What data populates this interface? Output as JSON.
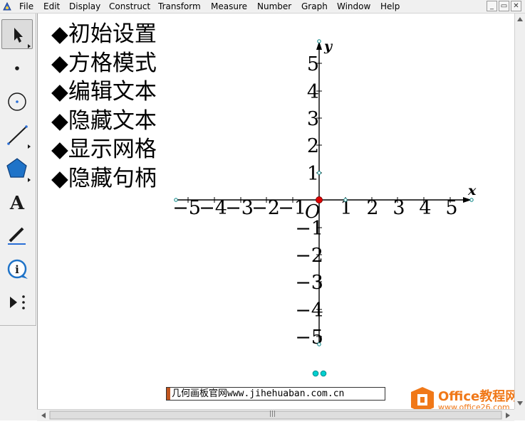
{
  "menu": [
    "File",
    "Edit",
    "Display",
    "Construct",
    "Transform",
    "Measure",
    "Number",
    "Graph",
    "Window",
    "Help"
  ],
  "window_buttons": {
    "minimize": "_",
    "restore": "▭",
    "close": "✕"
  },
  "tools": [
    "arrow-select-icon",
    "point-tool-icon",
    "compass-icon",
    "straightedge-icon",
    "polygon-icon",
    "text-tool-icon",
    "marker-icon",
    "information-icon",
    "custom-tool-icon"
  ],
  "text_items": [
    "◆初始设置",
    "◆方格模式",
    "◆编辑文本",
    "◆隐藏文本",
    "◆显示网格",
    "◆隐藏句柄"
  ],
  "axes": {
    "x_name": "x",
    "y_name": "y",
    "origin": "O",
    "x_ticks": [
      "−5",
      "−4",
      "−3",
      "−2",
      "−1",
      "1",
      "2",
      "3",
      "4",
      "5"
    ],
    "y_ticks_pos": [
      "5",
      "4",
      "3",
      "2",
      "1"
    ],
    "y_ticks_neg": [
      "−1",
      "−2",
      "−3",
      "−4",
      "−5"
    ]
  },
  "colors": {
    "origin_point": "#e00000",
    "handle_point": "#00c8c8",
    "axis": "#000000",
    "watermark": "#f07818"
  },
  "caption": "几何画板官网www.jihehuaban.com.cn",
  "watermark": {
    "title": "Office教程网",
    "url": "www.office26.com"
  },
  "scroll": {
    "h_thumb": "|||"
  }
}
